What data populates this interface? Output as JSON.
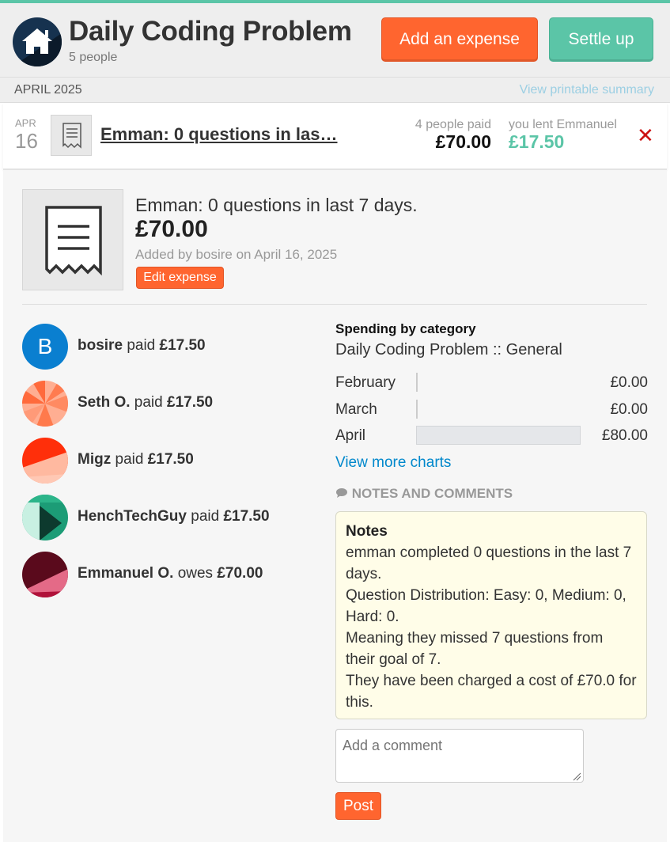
{
  "group": {
    "title": "Daily Coding Problem",
    "members": "5 people",
    "add_expense_label": "Add an expense",
    "settle_up_label": "Settle up"
  },
  "month_bar": {
    "month": "APRIL 2025",
    "printable_link": "View printable summary"
  },
  "expense_row": {
    "month": "APR",
    "day": "16",
    "title": "Emman: 0 questions in las…",
    "paid_label": "4 people paid",
    "paid_amount": "£70.00",
    "lent_label": "you lent Emmanuel",
    "lent_amount": "£17.50",
    "delete_glyph": "✕"
  },
  "details": {
    "title": "Emman: 0 questions in last 7 days.",
    "amount": "£70.00",
    "added_by": "Added by bosire on April 16, 2025",
    "edit_label": "Edit expense",
    "people": [
      {
        "name": "bosire",
        "action": "paid",
        "amount": "£17.50",
        "avatar_letter": "B"
      },
      {
        "name": "Seth O.",
        "action": "paid",
        "amount": "£17.50"
      },
      {
        "name": "Migz",
        "action": "paid",
        "amount": "£17.50"
      },
      {
        "name": "HenchTechGuy",
        "action": "paid",
        "amount": "£17.50"
      },
      {
        "name": "Emmanuel O.",
        "action": "owes",
        "amount": "£70.00"
      }
    ]
  },
  "category": {
    "heading": "Spending by category",
    "name": "Daily Coding Problem :: General",
    "more_charts": "View more charts"
  },
  "chart_data": {
    "type": "bar",
    "categories": [
      "February",
      "March",
      "April"
    ],
    "values": [
      0.0,
      0.0,
      80.0
    ],
    "value_labels": [
      "£0.00",
      "£0.00",
      "£80.00"
    ],
    "orientation": "horizontal"
  },
  "notes": {
    "heading": "NOTES AND COMMENTS",
    "title": "Notes",
    "lines": [
      "emman completed 0 questions in the last 7",
      "days.",
      "Question Distribution: Easy: 0, Medium: 0,",
      "Hard: 0.",
      "Meaning they missed 7 questions from",
      "their goal of 7.",
      "They have been charged a cost of £70.0 for",
      "this."
    ]
  },
  "comment": {
    "placeholder": "Add a comment",
    "post_label": "Post"
  },
  "colors": {
    "brand_green": "#5bc5a7",
    "brand_orange": "#ff652f",
    "link_blue": "#0088cc",
    "delete_red": "#cc1111"
  },
  "icons": [
    "home-icon",
    "receipt-icon",
    "close-icon",
    "comment-icon"
  ]
}
